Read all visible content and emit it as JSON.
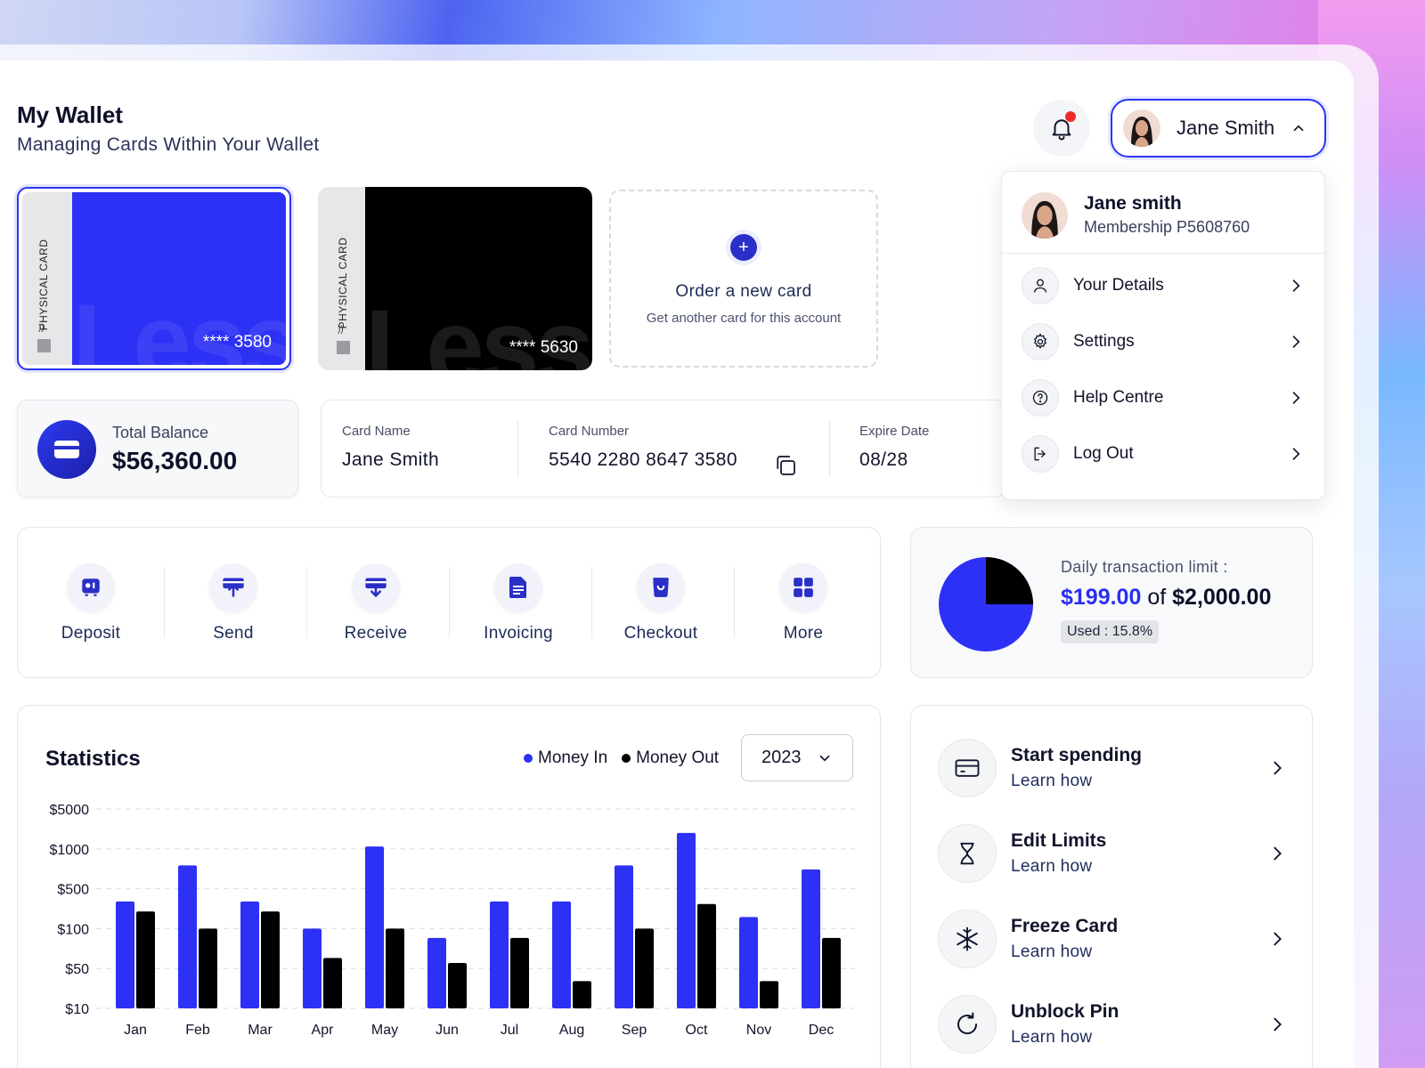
{
  "header": {
    "title": "My Wallet",
    "subtitle": "Managing Cards Within Your Wallet",
    "user_name": "Jane Smith"
  },
  "user_menu": {
    "name": "Jane smith",
    "membership": "Membership P5608760",
    "items": [
      {
        "label": "Your Details",
        "icon": "user-icon"
      },
      {
        "label": "Settings",
        "icon": "gear-icon"
      },
      {
        "label": "Help Centre",
        "icon": "help-icon"
      },
      {
        "label": "Log Out",
        "icon": "logout-icon"
      }
    ]
  },
  "cards": [
    {
      "type_label": "PHYSICAL CARD",
      "masked_number": "**** 3580",
      "watermark": "Less",
      "color": "#2d30f5",
      "selected": true
    },
    {
      "type_label": "PHYSICAL CARD",
      "masked_number": "**** 5630",
      "watermark": "Less",
      "color": "#000000",
      "selected": false
    }
  ],
  "order_card": {
    "title": "Order a new card",
    "subtitle": "Get another card for this account"
  },
  "balance": {
    "label": "Total Balance",
    "value": "$56,360.00"
  },
  "card_info": {
    "name_label": "Card Name",
    "name_value": "Jane Smith",
    "number_label": "Card Number",
    "number_value": "5540 2280 8647 3580",
    "expiry_label": "Expire Date",
    "expiry_value": "08/28"
  },
  "actions": [
    {
      "label": "Deposit",
      "icon": "deposit-icon"
    },
    {
      "label": "Send",
      "icon": "send-icon"
    },
    {
      "label": "Receive",
      "icon": "receive-icon"
    },
    {
      "label": "Invoicing",
      "icon": "invoice-icon"
    },
    {
      "label": "Checkout",
      "icon": "bag-icon"
    },
    {
      "label": "More",
      "icon": "grid-icon"
    }
  ],
  "limit": {
    "label": "Daily transaction limit :",
    "used_amount": "$199.00",
    "of_text": "of",
    "total_amount": "$2,000.00",
    "used_text": "Used : 15.8%",
    "used_fraction": 0.25
  },
  "statistics": {
    "title": "Statistics",
    "legend_in": "Money In",
    "legend_out": "Money Out",
    "year": "2023"
  },
  "colors": {
    "accent": "#2a2ff0",
    "money_in": "#2d30f5",
    "money_out": "#000000"
  },
  "chart_data": {
    "type": "bar",
    "categories": [
      "Jan",
      "Feb",
      "Mar",
      "Apr",
      "May",
      "Jun",
      "Jul",
      "Aug",
      "Sep",
      "Oct",
      "Nov",
      "Dec"
    ],
    "y_ticks": [
      "$5000",
      "$1000",
      "$500",
      "$100",
      "$50",
      "$10"
    ],
    "y_tick_values": [
      5000,
      1000,
      500,
      100,
      50,
      10
    ],
    "series": [
      {
        "name": "Money In",
        "values": [
          300,
          750,
          300,
          100,
          1100,
          85,
          300,
          300,
          750,
          1900,
          160,
          700
        ]
      },
      {
        "name": "Money Out",
        "values": [
          200,
          100,
          200,
          60,
          100,
          55,
          85,
          30,
          100,
          270,
          30,
          85
        ]
      }
    ],
    "grid": true,
    "legend": "top-right"
  },
  "tips": [
    {
      "title": "Start spending",
      "subtitle": "Learn how",
      "icon": "card-icon"
    },
    {
      "title": "Edit Limits",
      "subtitle": "Learn how",
      "icon": "hourglass-icon"
    },
    {
      "title": "Freeze Card",
      "subtitle": "Learn how",
      "icon": "snowflake-icon"
    },
    {
      "title": "Unblock Pin",
      "subtitle": "Learn how",
      "icon": "refresh-icon"
    }
  ]
}
